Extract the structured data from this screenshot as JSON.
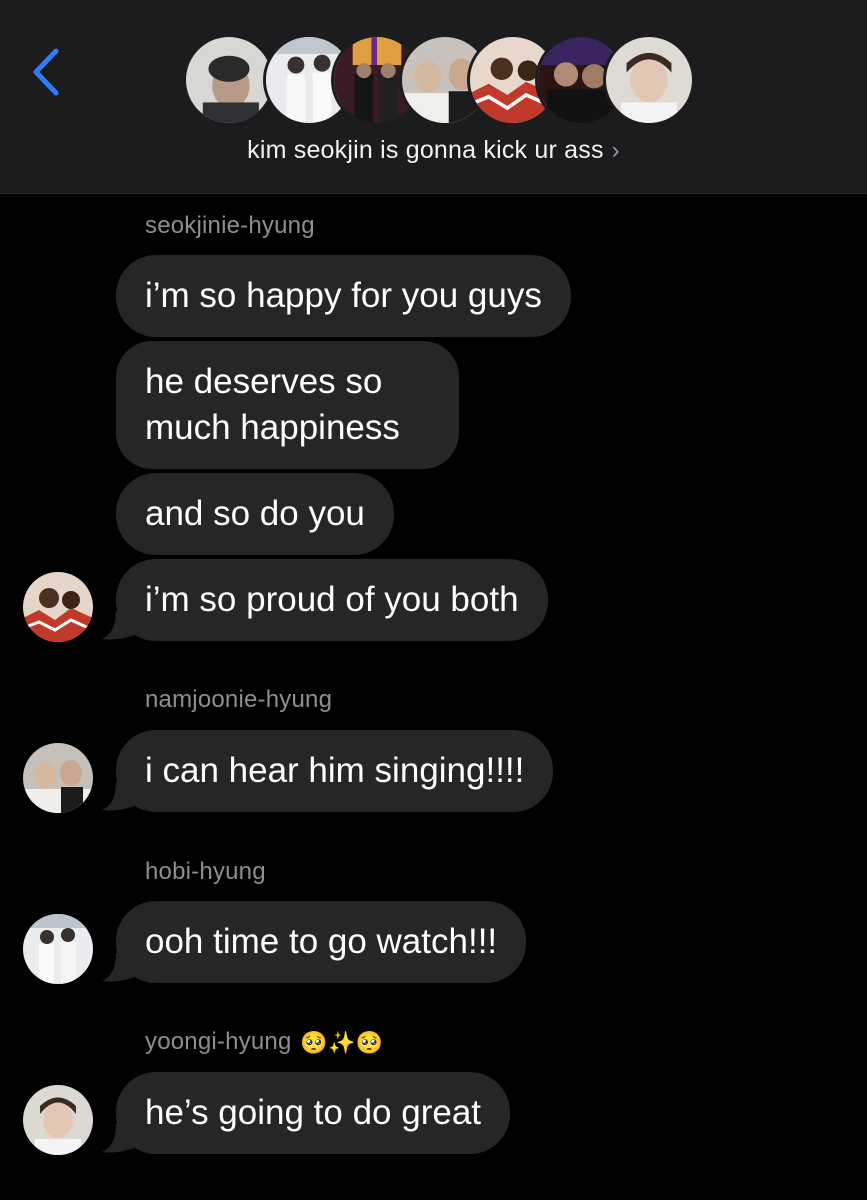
{
  "header": {
    "back_icon": "chevron-left-icon",
    "group_name": "kim seokjin is gonna kick ur ass",
    "chevron": "›",
    "member_avatar_count": 7
  },
  "messages": [
    {
      "sender": "seokjinie-hyung",
      "bubbles": [
        "i’m so happy for you guys",
        "he deserves so much happiness",
        "and so do you",
        "i’m so proud of you both"
      ]
    },
    {
      "sender": "namjoonie-hyung",
      "bubbles": [
        "i can hear him singing!!!!"
      ]
    },
    {
      "sender": "hobi-hyung",
      "bubbles": [
        "ooh time to go watch!!!"
      ]
    },
    {
      "sender": "yoongi-hyung",
      "sender_emoji": "🥺✨🥺",
      "bubbles": [
        "he’s going to do great"
      ]
    }
  ],
  "colors": {
    "background": "#000000",
    "header": "#1c1c1e",
    "bubble": "#262628",
    "accent": "#2f7cf6",
    "sender_text": "#8e8e93"
  }
}
